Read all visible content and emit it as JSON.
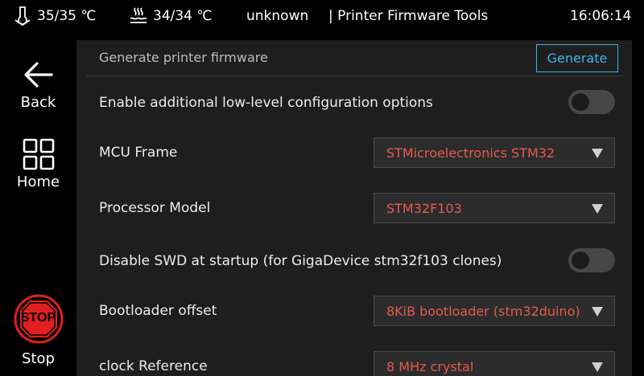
{
  "statusbar": {
    "extruder_temp": "35/35 ℃",
    "bed_temp": "34/34 ℃",
    "printer_name": "unknown",
    "app_title": "| Printer Firmware Tools",
    "time": "16:06:14"
  },
  "rail": {
    "back_label": "Back",
    "home_label": "Home",
    "stop_label": "Stop",
    "stop_badge": "STOP"
  },
  "panel": {
    "title": "Generate printer firmware",
    "generate_label": "Generate",
    "rows": [
      {
        "label": "Enable additional low-level configuration options",
        "type": "toggle",
        "on": false
      },
      {
        "label": "MCU Frame",
        "type": "select",
        "value": "STMicroelectronics STM32"
      },
      {
        "label": "Processor Model",
        "type": "select",
        "value": "STM32F103"
      },
      {
        "label": "Disable SWD at startup (for GigaDevice stm32f103 clones)",
        "type": "toggle",
        "on": false
      },
      {
        "label": "Bootloader offset",
        "type": "select",
        "value": "8KiB bootloader (stm32duino)"
      },
      {
        "label": "clock Reference",
        "type": "select",
        "value": "8 MHz crystal"
      }
    ]
  },
  "colors": {
    "accent": "#3fb5ea",
    "value_text": "#e45b4f",
    "stop_red": "#e02020",
    "panel_bg": "#1e1e1e"
  },
  "icons": {
    "extruder": "nozzle-thermometer-icon",
    "bed": "heated-bed-icon",
    "back": "arrow-left-icon",
    "home": "grid-icon",
    "stop": "stop-octagon-icon"
  }
}
